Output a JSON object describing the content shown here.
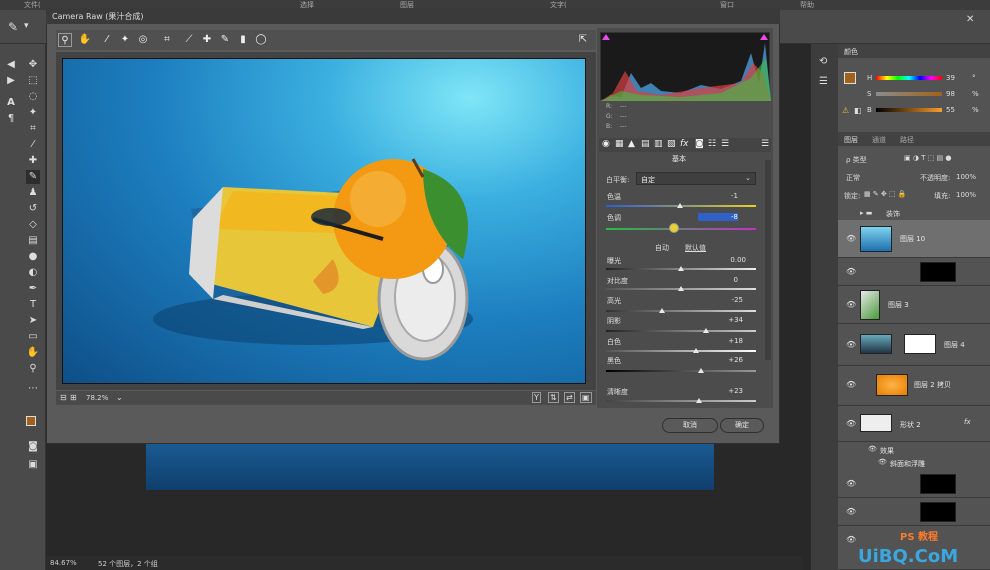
{
  "ps": {
    "menu": [
      "文件(",
      "选择",
      "图层",
      "文字(",
      "窗口",
      "帮助"
    ],
    "status_zoom": "84.67%",
    "status_info": "52 个图层，2 个组"
  },
  "color_panel": {
    "tab": "颜色",
    "h_label": "H",
    "h_value": "39",
    "h_unit": "°",
    "s_label": "S",
    "s_value": "98",
    "s_unit": "%",
    "b_label": "B",
    "b_value": "55",
    "b_unit": "%"
  },
  "layers_panel": {
    "tabs": [
      "图层",
      "通道",
      "路径"
    ],
    "filter_label": "ρ 类型",
    "blend_mode": "正常",
    "opacity_label": "不透明度:",
    "opacity_value": "100%",
    "lock_label": "锁定:",
    "fill_label": "填充:",
    "fill_value": "100%",
    "group_name": "装饰",
    "layers": [
      {
        "name": "图层 10"
      },
      {
        "name": "图层 3"
      },
      {
        "name": "图层 4"
      },
      {
        "name": "图层 2 拷贝"
      },
      {
        "name": "形状 2"
      },
      {
        "name": "效果"
      },
      {
        "name": "斜面和浮雕"
      }
    ]
  },
  "camera_raw": {
    "title": "Camera Raw (果汁合成)",
    "zoom": "78.2%",
    "rgb": {
      "r_label": "R:",
      "g_label": "G:",
      "b_label": "B:",
      "r": "---",
      "g": "---",
      "b": "---"
    },
    "section_title": "基本",
    "wb_label": "白平衡:",
    "wb_value": "自定",
    "auto_link": "自动",
    "default_link": "默认值",
    "sliders": [
      {
        "label": "色温",
        "value": "-1"
      },
      {
        "label": "色调",
        "value": "-8"
      },
      {
        "label": "曝光",
        "value": "0.00"
      },
      {
        "label": "对比度",
        "value": "0"
      },
      {
        "label": "高光",
        "value": "-25"
      },
      {
        "label": "阴影",
        "value": "+34"
      },
      {
        "label": "白色",
        "value": "+18"
      },
      {
        "label": "黑色",
        "value": "+26"
      },
      {
        "label": "清晰度",
        "value": "+23"
      }
    ],
    "cancel_label": "取消",
    "ok_label": "确定"
  },
  "watermark": {
    "text": "UiBQ.CoM",
    "sub": "PS 教程"
  }
}
